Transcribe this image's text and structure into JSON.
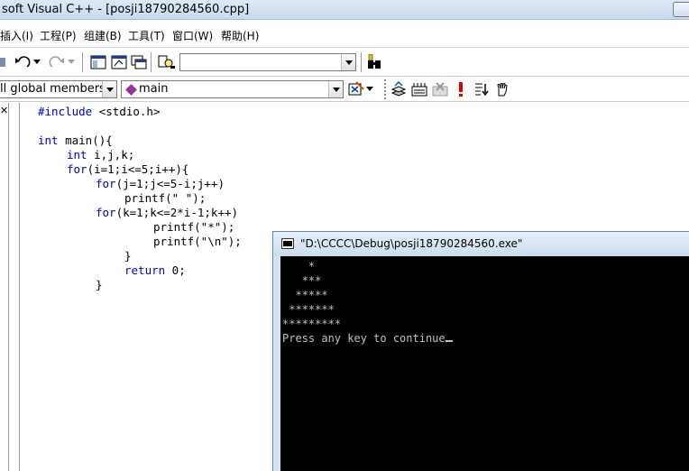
{
  "window": {
    "title": "soft Visual C++ - [posji18790284560.cpp]"
  },
  "menu": {
    "items": [
      "插入(I)",
      "工程(P)",
      "组建(B)",
      "工具(T)",
      "窗口(W)",
      "帮助(H)"
    ]
  },
  "toolbar": {
    "find_combo_value": "",
    "class_combo_value": "ll global members",
    "member_combo_value": "main",
    "icons": [
      "undo-icon",
      "redo-icon",
      "workspace-icon",
      "output-icon",
      "windows-icon",
      "find-in-files-icon",
      "find-icon",
      "wizardbar-icon",
      "compile-icon",
      "build-icon",
      "stop-build-icon",
      "execute-icon",
      "breakpoint-icon",
      "go-icon"
    ]
  },
  "editor": {
    "lines": [
      {
        "text": "#include <stdio.h>"
      },
      {
        "text": ""
      },
      {
        "text": "int main(){"
      },
      {
        "text": "    int i,j,k;"
      },
      {
        "text": "    for(i=1;i<=5;i++){"
      },
      {
        "text": "        for(j=1;j<=5-i;j++)"
      },
      {
        "text": "            printf(\" \");"
      },
      {
        "text": "        for(k=1;k<=2*i-1;k++)"
      },
      {
        "text": "                printf(\"*\");"
      },
      {
        "text": "                printf(\"\\n\");"
      },
      {
        "text": "            }"
      },
      {
        "text": "            return 0;"
      },
      {
        "text": "        }"
      }
    ]
  },
  "console": {
    "title": "\"D:\\CCCC\\Debug\\posji18790284560.exe\"",
    "output": [
      "    *",
      "   ***",
      "  *****",
      " *******",
      "*********",
      "Press any key to continue"
    ]
  }
}
